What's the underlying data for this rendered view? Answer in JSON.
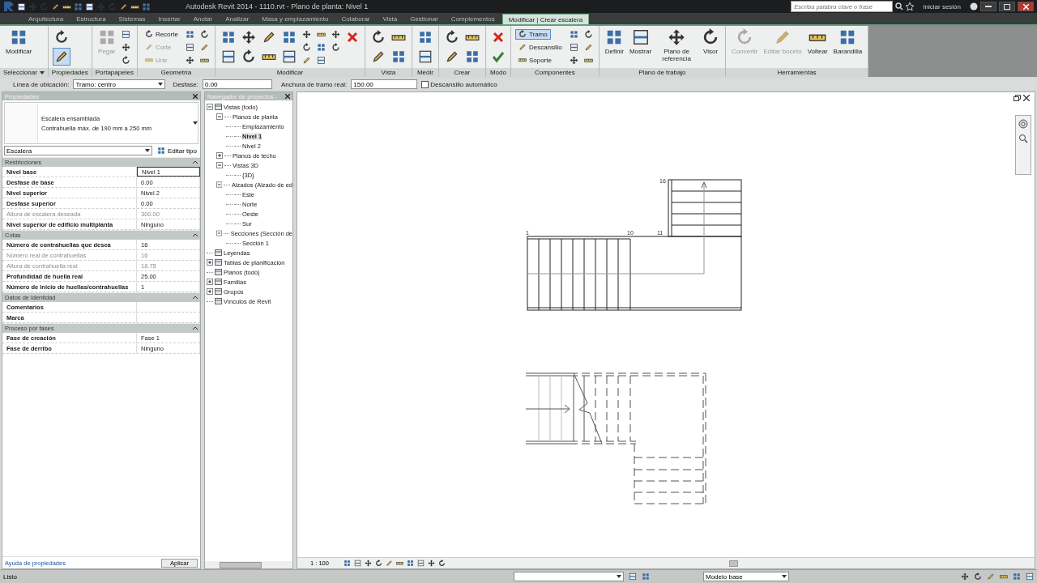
{
  "title_bar": {
    "title": "Autodesk Revit 2014 -   1110.rvt - Plano de planta: Nivel 1",
    "search": {
      "placeholder": "Escriba palabra clave o frase"
    },
    "sign_in": "Iniciar sesión"
  },
  "tabs": [
    {
      "label": "Arquitectura",
      "selected": false
    },
    {
      "label": "Estructura",
      "selected": false
    },
    {
      "label": "Sistemas",
      "selected": false
    },
    {
      "label": "Insertar",
      "selected": false
    },
    {
      "label": "Anotar",
      "selected": false
    },
    {
      "label": "Analizar",
      "selected": false
    },
    {
      "label": "Masa y emplazamiento",
      "selected": false
    },
    {
      "label": "Colaborar",
      "selected": false
    },
    {
      "label": "Vista",
      "selected": false
    },
    {
      "label": "Gestionar",
      "selected": false
    },
    {
      "label": "Complementos",
      "selected": false
    },
    {
      "label": "Modificar | Crear escalera",
      "selected": true
    }
  ],
  "ribbon": {
    "panels": [
      {
        "label": "Seleccionar",
        "dropdown": true,
        "items": [
          {
            "kind": "large",
            "label": "Modificar",
            "disabled": false
          }
        ]
      },
      {
        "label": "Propiedades",
        "dropdown": false,
        "items": [
          {
            "kind": "medium",
            "selected": false
          },
          {
            "kind": "medium",
            "selected": true
          }
        ]
      },
      {
        "label": "Portapapeles",
        "dropdown": false,
        "items": [
          {
            "kind": "large",
            "label": "Pegar",
            "disabled": true
          },
          {
            "kind": "icon"
          },
          {
            "kind": "icon"
          },
          {
            "kind": "icon"
          }
        ]
      },
      {
        "label": "Geometría",
        "dropdown": false,
        "items": [
          {
            "kind": "small",
            "label": "Recorte",
            "disabled": false
          },
          {
            "kind": "small",
            "label": "Corte",
            "disabled": true
          },
          {
            "kind": "small",
            "label": "Unir",
            "disabled": true
          },
          {
            "kind": "icon"
          },
          {
            "kind": "icon"
          },
          {
            "kind": "icon"
          },
          {
            "kind": "icon"
          },
          {
            "kind": "icon"
          },
          {
            "kind": "icon"
          }
        ]
      },
      {
        "label": "Modificar",
        "dropdown": false,
        "items": [
          {
            "kind": "medium"
          },
          {
            "kind": "medium"
          },
          {
            "kind": "medium"
          },
          {
            "kind": "medium"
          },
          {
            "kind": "medium"
          },
          {
            "kind": "medium"
          },
          {
            "kind": "medium"
          },
          {
            "kind": "medium"
          },
          {
            "kind": "icon"
          },
          {
            "kind": "icon"
          },
          {
            "kind": "icon"
          },
          {
            "kind": "icon"
          },
          {
            "kind": "icon"
          },
          {
            "kind": "icon"
          },
          {
            "kind": "icon"
          },
          {
            "kind": "icon"
          },
          {
            "kind": "cancel"
          }
        ]
      },
      {
        "label": "Vista",
        "dropdown": false,
        "items": [
          {
            "kind": "medium"
          },
          {
            "kind": "medium"
          },
          {
            "kind": "medium"
          },
          {
            "kind": "medium"
          }
        ]
      },
      {
        "label": "Medir",
        "dropdown": false,
        "items": [
          {
            "kind": "medium"
          },
          {
            "kind": "medium"
          }
        ]
      },
      {
        "label": "Crear",
        "dropdown": false,
        "items": [
          {
            "kind": "medium"
          },
          {
            "kind": "medium"
          },
          {
            "kind": "medium"
          },
          {
            "kind": "medium"
          }
        ]
      },
      {
        "label": "Modo",
        "dropdown": false,
        "items": [
          {
            "kind": "cancel"
          },
          {
            "kind": "finish"
          }
        ]
      },
      {
        "label": "Componentes",
        "dropdown": false,
        "items": [
          {
            "kind": "small",
            "label": "Tramo",
            "selected": true
          },
          {
            "kind": "small",
            "label": "Descansillo",
            "selected": false
          },
          {
            "kind": "small",
            "label": "Soporte",
            "selected": false
          },
          {
            "kind": "icon",
            "selected": false
          },
          {
            "kind": "icon",
            "selected": false
          },
          {
            "kind": "icon",
            "selected": false
          },
          {
            "kind": "icon",
            "selected": false
          },
          {
            "kind": "icon",
            "selected": false
          },
          {
            "kind": "icon",
            "selected": false
          }
        ]
      },
      {
        "label": "Plano de trabajo",
        "dropdown": false,
        "items": [
          {
            "kind": "large",
            "label": "Definir",
            "disabled": false
          },
          {
            "kind": "large",
            "label": "Mostrar",
            "disabled": false
          },
          {
            "kind": "large",
            "label": "Plano de referencia",
            "disabled": false
          },
          {
            "kind": "large",
            "label": "Visor",
            "disabled": false
          }
        ]
      },
      {
        "label": "Herramientas",
        "dropdown": false,
        "items": [
          {
            "kind": "large",
            "label": "Convertir",
            "disabled": true
          },
          {
            "kind": "large",
            "label": "Editar boceto",
            "disabled": true
          },
          {
            "kind": "large",
            "label": "Voltear",
            "disabled": false
          },
          {
            "kind": "large",
            "label": "Barandilla",
            "disabled": false
          }
        ]
      }
    ]
  },
  "options_bar": {
    "location_label": "Línea de ubicación:",
    "location_value": "Tramo: centro",
    "offset_label": "Desfase:",
    "offset_value": "0.00",
    "width_label": "Anchura de tramo real:",
    "width_value": "150.00",
    "auto_landing": {
      "label": "Descansillo automático",
      "checked": false
    }
  },
  "properties": {
    "title": "Propiedades",
    "type_name": "Escalera ensamblada",
    "type_detail": "Contrahuella máx. de 190 mm a 250 mm",
    "filter": "Escalera",
    "edit_type": "Editar tipo",
    "groups": [
      {
        "label": "Restricciones",
        "expanded": true,
        "rows": [
          {
            "label": "Nivel base",
            "value": "Nivel 1",
            "disabled": false,
            "selected": true
          },
          {
            "label": "Desfase de base",
            "value": "0.00",
            "disabled": false,
            "selected": false
          },
          {
            "label": "Nivel superior",
            "value": "Nivel 2",
            "disabled": false,
            "selected": false
          },
          {
            "label": "Desfase superior",
            "value": "0.00",
            "disabled": false,
            "selected": false
          },
          {
            "label": "Altura de escalera deseada",
            "value": "300.00",
            "disabled": true,
            "selected": false
          },
          {
            "label": "Nivel superior de edificio multiplanta",
            "value": "Ninguno",
            "disabled": false,
            "selected": false
          }
        ]
      },
      {
        "label": "Cotas",
        "expanded": true,
        "rows": [
          {
            "label": "Número de contrahuellas que desea",
            "value": "16",
            "disabled": false,
            "selected": false
          },
          {
            "label": "Número real de contrahuellas",
            "value": "16",
            "disabled": true,
            "selected": false
          },
          {
            "label": "Altura de contrahuella real",
            "value": "18.75",
            "disabled": true,
            "selected": false
          },
          {
            "label": "Profundidad de huella real",
            "value": "25.00",
            "disabled": false,
            "selected": false
          },
          {
            "label": "Número de inicio de huellas/contrahuellas",
            "value": "1",
            "disabled": false,
            "selected": false
          }
        ]
      },
      {
        "label": "Datos de identidad",
        "expanded": true,
        "rows": [
          {
            "label": "Comentarios",
            "disabled": false,
            "selected": false
          },
          {
            "label": "Marca",
            "disabled": false,
            "selected": false
          }
        ]
      },
      {
        "label": "Proceso por fases",
        "expanded": true,
        "rows": [
          {
            "label": "Fase de creación",
            "value": "Fase 1",
            "disabled": false,
            "selected": false
          },
          {
            "label": "Fase de derribo",
            "value": "Ninguno",
            "disabled": false,
            "selected": false
          }
        ]
      }
    ],
    "help_link": "Ayuda de propiedades",
    "apply": "Aplicar"
  },
  "project_browser": {
    "title": "Navegador de proyectos -",
    "tree": [
      {
        "label": "Vistas (todo)",
        "expanded": true,
        "selected": false,
        "children": [
          {
            "label": "Planos de planta",
            "expanded": true,
            "selected": false,
            "children": [
              {
                "label": "Emplazamiento",
                "selected": false
              },
              {
                "label": "Nivel 1",
                "selected": true
              },
              {
                "label": "Nivel 2",
                "selected": false
              }
            ]
          },
          {
            "label": "Planos de techo",
            "expanded": false,
            "selected": false
          },
          {
            "label": "Vistas 3D",
            "expanded": true,
            "selected": false,
            "children": [
              {
                "label": "{3D}",
                "selected": false
              }
            ]
          },
          {
            "label": "Alzados (Alzado de ed",
            "expanded": true,
            "selected": false,
            "children": [
              {
                "label": "Este",
                "selected": false
              },
              {
                "label": "Norte",
                "selected": false
              },
              {
                "label": "Oeste",
                "selected": false
              },
              {
                "label": "Sur",
                "selected": false
              }
            ]
          },
          {
            "label": "Secciones (Sección de",
            "expanded": true,
            "selected": false,
            "children": [
              {
                "label": "Sección 1",
                "selected": false
              }
            ]
          }
        ]
      },
      {
        "label": "Leyendas",
        "selected": false
      },
      {
        "label": "Tablas de planificación",
        "expanded": false,
        "selected": false
      },
      {
        "label": "Planos (todo)",
        "selected": false
      },
      {
        "label": "Familias",
        "expanded": false,
        "selected": false
      },
      {
        "label": "Grupos",
        "expanded": false,
        "selected": false
      },
      {
        "label": "Vínculos de Revit",
        "selected": false
      }
    ]
  },
  "drawing": {
    "riser_labels": [
      "16",
      "1",
      "10",
      "11"
    ]
  },
  "view_bar": {
    "scale": "1 : 100"
  },
  "status_bar": {
    "message": "Listo",
    "model": "Modelo base"
  }
}
